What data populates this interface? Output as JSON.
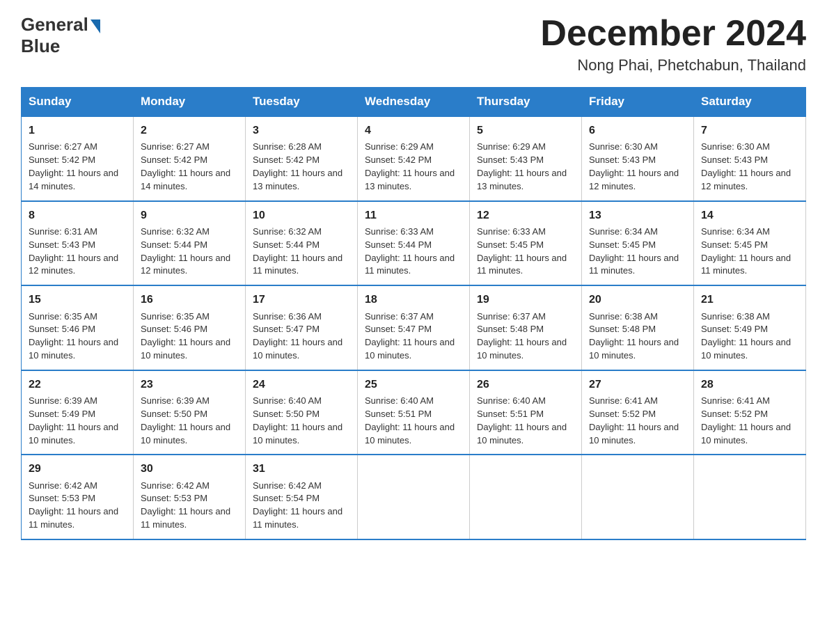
{
  "header": {
    "logo_general": "General",
    "logo_blue": "Blue",
    "month_year": "December 2024",
    "location": "Nong Phai, Phetchabun, Thailand"
  },
  "days_of_week": [
    "Sunday",
    "Monday",
    "Tuesday",
    "Wednesday",
    "Thursday",
    "Friday",
    "Saturday"
  ],
  "weeks": [
    [
      {
        "day": "1",
        "sunrise": "6:27 AM",
        "sunset": "5:42 PM",
        "daylight": "11 hours and 14 minutes."
      },
      {
        "day": "2",
        "sunrise": "6:27 AM",
        "sunset": "5:42 PM",
        "daylight": "11 hours and 14 minutes."
      },
      {
        "day": "3",
        "sunrise": "6:28 AM",
        "sunset": "5:42 PM",
        "daylight": "11 hours and 13 minutes."
      },
      {
        "day": "4",
        "sunrise": "6:29 AM",
        "sunset": "5:42 PM",
        "daylight": "11 hours and 13 minutes."
      },
      {
        "day": "5",
        "sunrise": "6:29 AM",
        "sunset": "5:43 PM",
        "daylight": "11 hours and 13 minutes."
      },
      {
        "day": "6",
        "sunrise": "6:30 AM",
        "sunset": "5:43 PM",
        "daylight": "11 hours and 12 minutes."
      },
      {
        "day": "7",
        "sunrise": "6:30 AM",
        "sunset": "5:43 PM",
        "daylight": "11 hours and 12 minutes."
      }
    ],
    [
      {
        "day": "8",
        "sunrise": "6:31 AM",
        "sunset": "5:43 PM",
        "daylight": "11 hours and 12 minutes."
      },
      {
        "day": "9",
        "sunrise": "6:32 AM",
        "sunset": "5:44 PM",
        "daylight": "11 hours and 12 minutes."
      },
      {
        "day": "10",
        "sunrise": "6:32 AM",
        "sunset": "5:44 PM",
        "daylight": "11 hours and 11 minutes."
      },
      {
        "day": "11",
        "sunrise": "6:33 AM",
        "sunset": "5:44 PM",
        "daylight": "11 hours and 11 minutes."
      },
      {
        "day": "12",
        "sunrise": "6:33 AM",
        "sunset": "5:45 PM",
        "daylight": "11 hours and 11 minutes."
      },
      {
        "day": "13",
        "sunrise": "6:34 AM",
        "sunset": "5:45 PM",
        "daylight": "11 hours and 11 minutes."
      },
      {
        "day": "14",
        "sunrise": "6:34 AM",
        "sunset": "5:45 PM",
        "daylight": "11 hours and 11 minutes."
      }
    ],
    [
      {
        "day": "15",
        "sunrise": "6:35 AM",
        "sunset": "5:46 PM",
        "daylight": "11 hours and 10 minutes."
      },
      {
        "day": "16",
        "sunrise": "6:35 AM",
        "sunset": "5:46 PM",
        "daylight": "11 hours and 10 minutes."
      },
      {
        "day": "17",
        "sunrise": "6:36 AM",
        "sunset": "5:47 PM",
        "daylight": "11 hours and 10 minutes."
      },
      {
        "day": "18",
        "sunrise": "6:37 AM",
        "sunset": "5:47 PM",
        "daylight": "11 hours and 10 minutes."
      },
      {
        "day": "19",
        "sunrise": "6:37 AM",
        "sunset": "5:48 PM",
        "daylight": "11 hours and 10 minutes."
      },
      {
        "day": "20",
        "sunrise": "6:38 AM",
        "sunset": "5:48 PM",
        "daylight": "11 hours and 10 minutes."
      },
      {
        "day": "21",
        "sunrise": "6:38 AM",
        "sunset": "5:49 PM",
        "daylight": "11 hours and 10 minutes."
      }
    ],
    [
      {
        "day": "22",
        "sunrise": "6:39 AM",
        "sunset": "5:49 PM",
        "daylight": "11 hours and 10 minutes."
      },
      {
        "day": "23",
        "sunrise": "6:39 AM",
        "sunset": "5:50 PM",
        "daylight": "11 hours and 10 minutes."
      },
      {
        "day": "24",
        "sunrise": "6:40 AM",
        "sunset": "5:50 PM",
        "daylight": "11 hours and 10 minutes."
      },
      {
        "day": "25",
        "sunrise": "6:40 AM",
        "sunset": "5:51 PM",
        "daylight": "11 hours and 10 minutes."
      },
      {
        "day": "26",
        "sunrise": "6:40 AM",
        "sunset": "5:51 PM",
        "daylight": "11 hours and 10 minutes."
      },
      {
        "day": "27",
        "sunrise": "6:41 AM",
        "sunset": "5:52 PM",
        "daylight": "11 hours and 10 minutes."
      },
      {
        "day": "28",
        "sunrise": "6:41 AM",
        "sunset": "5:52 PM",
        "daylight": "11 hours and 10 minutes."
      }
    ],
    [
      {
        "day": "29",
        "sunrise": "6:42 AM",
        "sunset": "5:53 PM",
        "daylight": "11 hours and 11 minutes."
      },
      {
        "day": "30",
        "sunrise": "6:42 AM",
        "sunset": "5:53 PM",
        "daylight": "11 hours and 11 minutes."
      },
      {
        "day": "31",
        "sunrise": "6:42 AM",
        "sunset": "5:54 PM",
        "daylight": "11 hours and 11 minutes."
      },
      null,
      null,
      null,
      null
    ]
  ],
  "labels": {
    "sunrise": "Sunrise:",
    "sunset": "Sunset:",
    "daylight": "Daylight:"
  }
}
